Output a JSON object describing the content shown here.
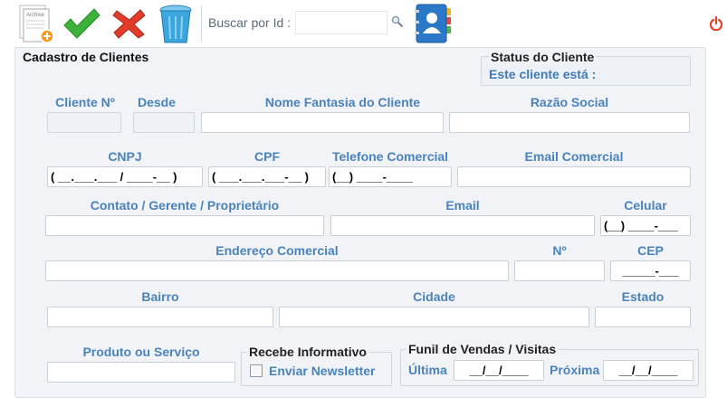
{
  "toolbar": {
    "search_label": "Buscar por Id :",
    "search_value": "",
    "new_doc_text": "Archive"
  },
  "form": {
    "title": "Cadastro de Clientes",
    "status": {
      "title": "Status do Cliente",
      "text": "Este cliente está :"
    },
    "labels": {
      "cliente_no": "Cliente Nº",
      "desde": "Desde",
      "nome_fantasia": "Nome Fantasia do Cliente",
      "razao_social": "Razão Social",
      "cnpj": "CNPJ",
      "cpf": "CPF",
      "telefone": "Telefone Comercial",
      "email_comercial": "Email Comercial",
      "contato": "Contato / Gerente / Proprietário",
      "email": "Email",
      "celular": "Celular",
      "endereco": "Endereço Comercial",
      "numero": "Nº",
      "cep": "CEP",
      "bairro": "Bairro",
      "cidade": "Cidade",
      "estado": "Estado",
      "produto": "Produto ou Serviço"
    },
    "values": {
      "cnpj": "( __.___.___ / ____-__ )",
      "cpf": "( ___.___.___-__ )",
      "telefone": "(__) ____-____",
      "celular": "(__) ____-___",
      "cep": "_____-___",
      "ultima": "__/__/____",
      "proxima": "__/__/____"
    },
    "informativo": {
      "title": "Recebe Informativo",
      "newsletter_label": "Enviar Newsletter",
      "checked": false
    },
    "funil": {
      "title": "Funil de Vendas / Visitas",
      "ultima_label": "Última",
      "proxima_label": "Próxima"
    }
  },
  "colors": {
    "label": "#4a83bc",
    "panel": "#f1f3f6",
    "power": "#e2412d"
  }
}
